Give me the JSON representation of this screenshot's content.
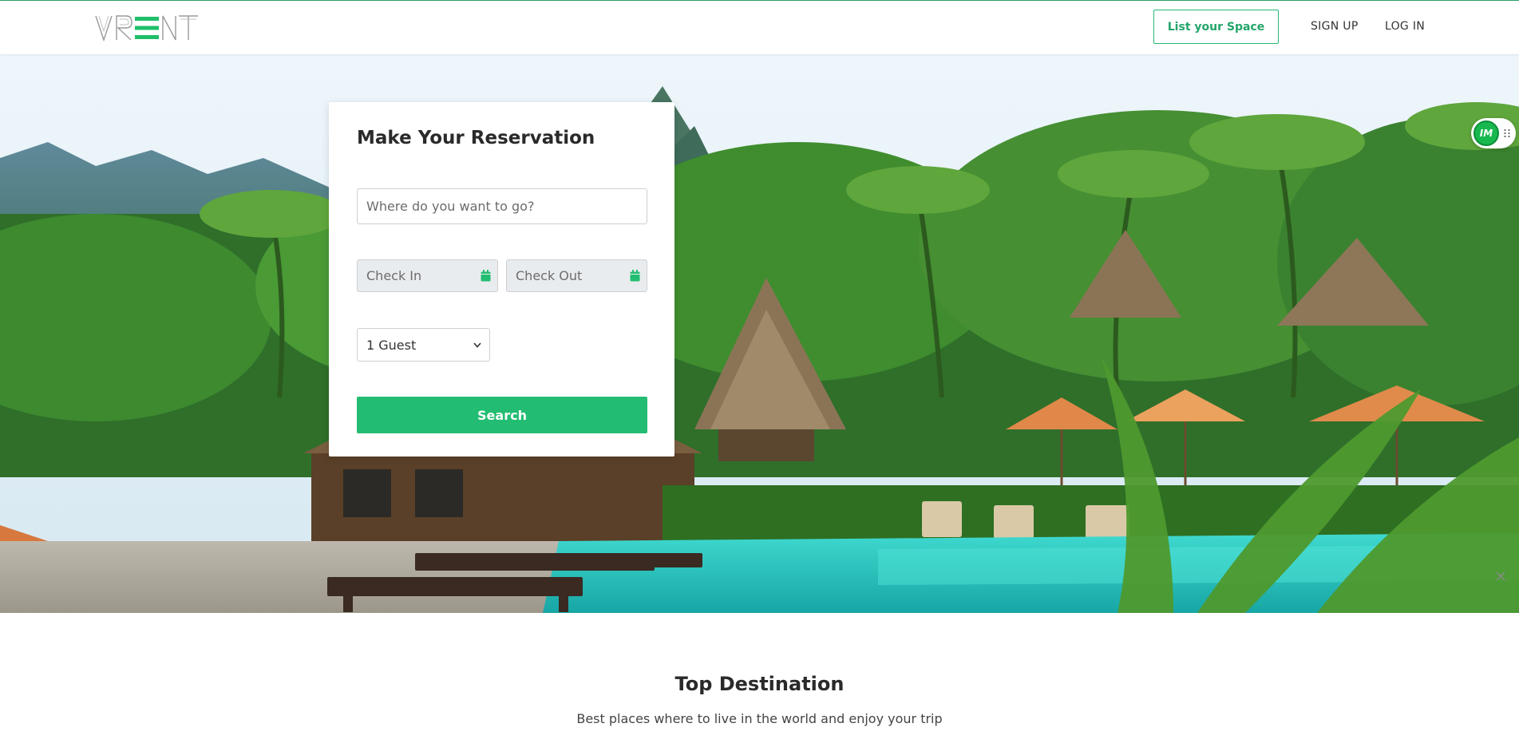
{
  "header": {
    "logo_text": "VRENT",
    "list_space_label": "List your Space",
    "signup_label": "SIGN UP",
    "login_label": "LOG IN"
  },
  "reservation": {
    "title": "Make Your Reservation",
    "where_placeholder": "Where do you want to go?",
    "check_in_placeholder": "Check In",
    "check_out_placeholder": "Check Out",
    "guest_value": "1 Guest",
    "search_label": "Search"
  },
  "widget": {
    "badge_text": "IM"
  },
  "destinations": {
    "title": "Top Destination",
    "subtitle": "Best places where to live in the world and enjoy your trip"
  },
  "colors": {
    "accent": "#22bd72",
    "header_border": "#2c9b6a",
    "pool": "#2ed3c4"
  },
  "icons": [
    "calendar-icon",
    "chevron-down-icon",
    "drag-handle-icon",
    "close-icon"
  ]
}
